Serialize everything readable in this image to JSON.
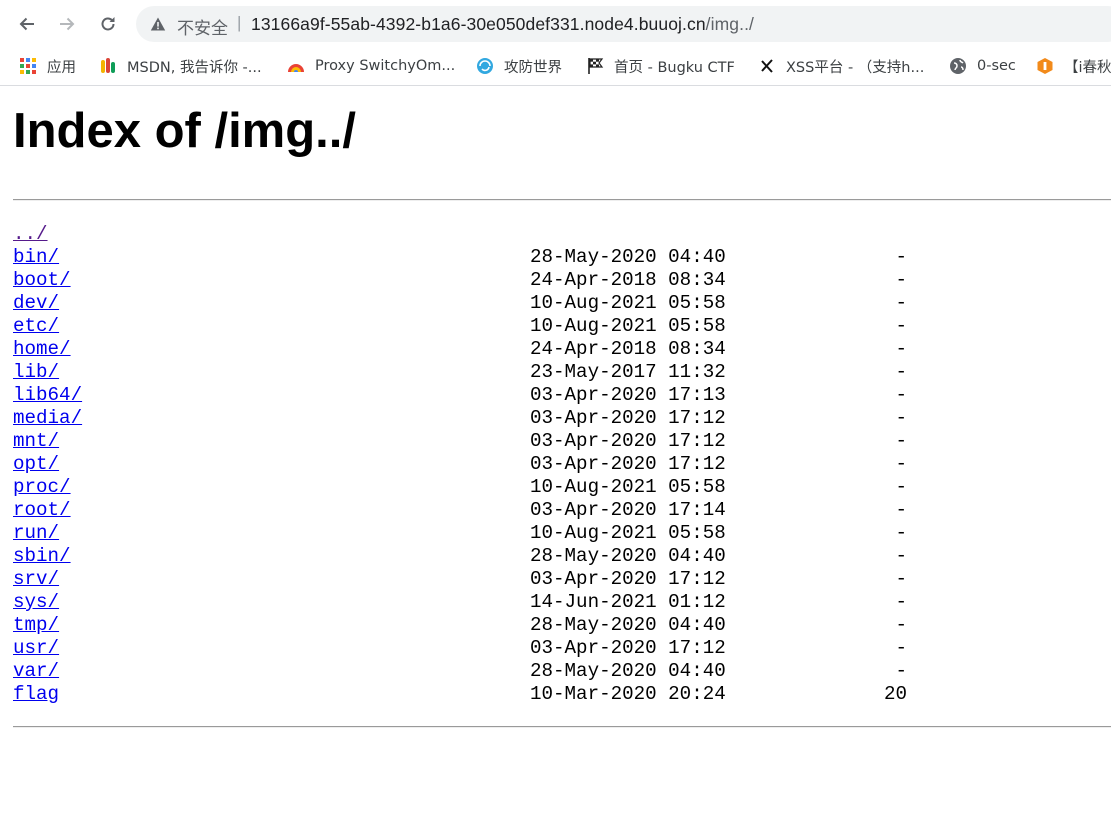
{
  "browser": {
    "security_label": "不安全",
    "separator": "|",
    "url_host": "13166a9f-55ab-4392-b1a6-30e050def331.node4.buuoj.cn",
    "url_path": "/img../",
    "back_icon": "arrow-left-icon",
    "forward_icon": "arrow-right-icon",
    "reload_icon": "reload-icon",
    "warning_icon": "warning-triangle-icon"
  },
  "bookmarks": [
    {
      "label": "应用",
      "icon": "apps-grid-icon"
    },
    {
      "label": "MSDN, 我告诉你 -...",
      "icon": "msdn-icon"
    },
    {
      "label": "Proxy SwitchyOm...",
      "icon": "proxy-icon"
    },
    {
      "label": "攻防世界",
      "icon": "globe-swirl-icon"
    },
    {
      "label": "首页 - Bugku CTF",
      "icon": "flag-icon"
    },
    {
      "label": "XSS平台 - （支持h...",
      "icon": "x-icon"
    },
    {
      "label": "0-sec",
      "icon": "globe-icon"
    },
    {
      "label": "【i春秋",
      "icon": "ichunqiu-icon"
    }
  ],
  "page": {
    "title": "Index of /img../",
    "entries": [
      {
        "name": "../",
        "date": "",
        "size": "",
        "visited": true
      },
      {
        "name": "bin/",
        "date": "28-May-2020 04:40",
        "size": "-"
      },
      {
        "name": "boot/",
        "date": "24-Apr-2018 08:34",
        "size": "-"
      },
      {
        "name": "dev/",
        "date": "10-Aug-2021 05:58",
        "size": "-"
      },
      {
        "name": "etc/",
        "date": "10-Aug-2021 05:58",
        "size": "-"
      },
      {
        "name": "home/",
        "date": "24-Apr-2018 08:34",
        "size": "-"
      },
      {
        "name": "lib/",
        "date": "23-May-2017 11:32",
        "size": "-"
      },
      {
        "name": "lib64/",
        "date": "03-Apr-2020 17:13",
        "size": "-"
      },
      {
        "name": "media/",
        "date": "03-Apr-2020 17:12",
        "size": "-"
      },
      {
        "name": "mnt/",
        "date": "03-Apr-2020 17:12",
        "size": "-"
      },
      {
        "name": "opt/",
        "date": "03-Apr-2020 17:12",
        "size": "-"
      },
      {
        "name": "proc/",
        "date": "10-Aug-2021 05:58",
        "size": "-"
      },
      {
        "name": "root/",
        "date": "03-Apr-2020 17:14",
        "size": "-"
      },
      {
        "name": "run/",
        "date": "10-Aug-2021 05:58",
        "size": "-"
      },
      {
        "name": "sbin/",
        "date": "28-May-2020 04:40",
        "size": "-"
      },
      {
        "name": "srv/",
        "date": "03-Apr-2020 17:12",
        "size": "-"
      },
      {
        "name": "sys/",
        "date": "14-Jun-2021 01:12",
        "size": "-"
      },
      {
        "name": "tmp/",
        "date": "28-May-2020 04:40",
        "size": "-"
      },
      {
        "name": "usr/",
        "date": "03-Apr-2020 17:12",
        "size": "-"
      },
      {
        "name": "var/",
        "date": "28-May-2020 04:40",
        "size": "-"
      },
      {
        "name": "flag",
        "date": "10-Mar-2020 20:24",
        "size": "20"
      }
    ]
  },
  "colors": {
    "link": "#0000ee",
    "visited_link": "#551a8b",
    "omnibox_bg": "#f1f3f4"
  }
}
